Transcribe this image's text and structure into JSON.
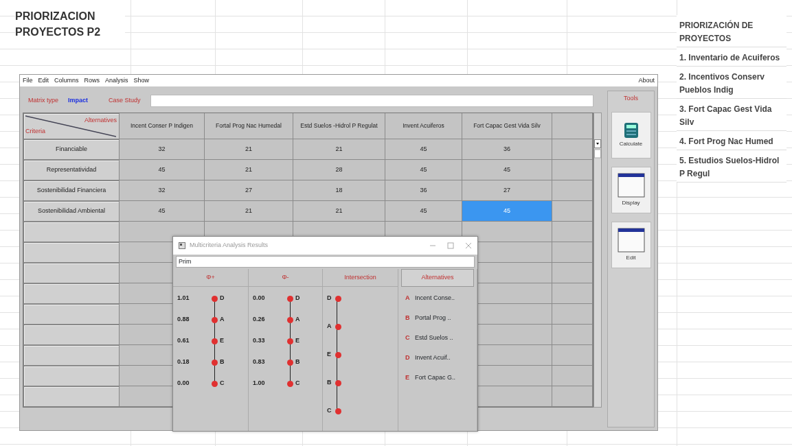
{
  "sheet_title": "PRIORIZACION PROYECTOS P2",
  "app": {
    "menu": [
      "File",
      "Edit",
      "Columns",
      "Rows",
      "Analysis",
      "Show"
    ],
    "about": "About",
    "matrix_type_label": "Matrix type",
    "matrix_type": "Impact",
    "case_study_label": "Case Study",
    "table": {
      "columns_label": "Alternatives",
      "rows_label": "Criteria",
      "columns": [
        "Incent Conser P Indigen",
        "Fortal Prog Nac Humedal",
        "Estd Suelos -Hidrol P Regulat",
        "Invent Acuiferos",
        "Fort Capac Gest Vida Silv"
      ],
      "rows": [
        {
          "label": "Financiable",
          "cells": [
            {
              "text": "32",
              "selected": false
            },
            {
              "text": "21",
              "selected": false
            },
            {
              "text": "21",
              "selected": false
            },
            {
              "text": "45",
              "selected": false
            },
            {
              "text": "36",
              "selected": false
            }
          ]
        },
        {
          "label": "Representatividad",
          "cells": [
            {
              "text": "45",
              "selected": false
            },
            {
              "text": "21",
              "selected": false
            },
            {
              "text": "28",
              "selected": false
            },
            {
              "text": "45",
              "selected": false
            },
            {
              "text": "45",
              "selected": false
            }
          ]
        },
        {
          "label": "Sostenibilidad Financiera",
          "cells": [
            {
              "text": "32",
              "selected": false
            },
            {
              "text": "27",
              "selected": false
            },
            {
              "text": "18",
              "selected": false
            },
            {
              "text": "36",
              "selected": false
            },
            {
              "text": "27",
              "selected": false
            }
          ]
        },
        {
          "label": "Sostenibilidad Ambiental",
          "cells": [
            {
              "text": "45",
              "selected": false
            },
            {
              "text": "21",
              "selected": false
            },
            {
              "text": "21",
              "selected": false
            },
            {
              "text": "45",
              "selected": false
            },
            {
              "text": "45",
              "selected": true
            }
          ]
        }
      ]
    },
    "tools": {
      "title": "Tools",
      "buttons": [
        {
          "label": "Calculate",
          "kind": "calculator"
        },
        {
          "label": "Display",
          "kind": "window"
        },
        {
          "label": "Edit",
          "kind": "window"
        }
      ]
    },
    "results": {
      "title": "Multicriteria Analysis Results",
      "field": "Prim",
      "headers": [
        "Φ+",
        "Φ-",
        "Intersection",
        "Alternatives"
      ],
      "phi_plus": [
        {
          "value": "1.01",
          "letter": "D"
        },
        {
          "value": "0.88",
          "letter": "A"
        },
        {
          "value": "0.61",
          "letter": "E"
        },
        {
          "value": "0.18",
          "letter": "B"
        },
        {
          "value": "0.00",
          "letter": "C"
        }
      ],
      "phi_minus": [
        {
          "value": "0.00",
          "letter": "D"
        },
        {
          "value": "0.26",
          "letter": "A"
        },
        {
          "value": "0.33",
          "letter": "E"
        },
        {
          "value": "0.83",
          "letter": "B"
        },
        {
          "value": "1.00",
          "letter": "C"
        }
      ],
      "intersection": [
        "D",
        "A",
        "E",
        "B",
        "C"
      ],
      "alternatives": [
        {
          "letter": "A",
          "name": "Incent Conse.."
        },
        {
          "letter": "B",
          "name": "Portal Prog .."
        },
        {
          "letter": "C",
          "name": "Estd Suelos .."
        },
        {
          "letter": "D",
          "name": "Invent Acuif.."
        },
        {
          "letter": "E",
          "name": "Fort Capac G.."
        }
      ]
    }
  },
  "sheet_list": {
    "heading": "PRIORIZACIÓN DE PROYECTOS",
    "items": [
      "1. Inventario de Acuiferos",
      "2. Incentivos Conserv Pueblos Indig",
      "3. Fort Capac Gest Vida Silv",
      "4. Fort Prog Nac Humed",
      "5. Estudios Suelos-Hidrol P Regul"
    ]
  }
}
